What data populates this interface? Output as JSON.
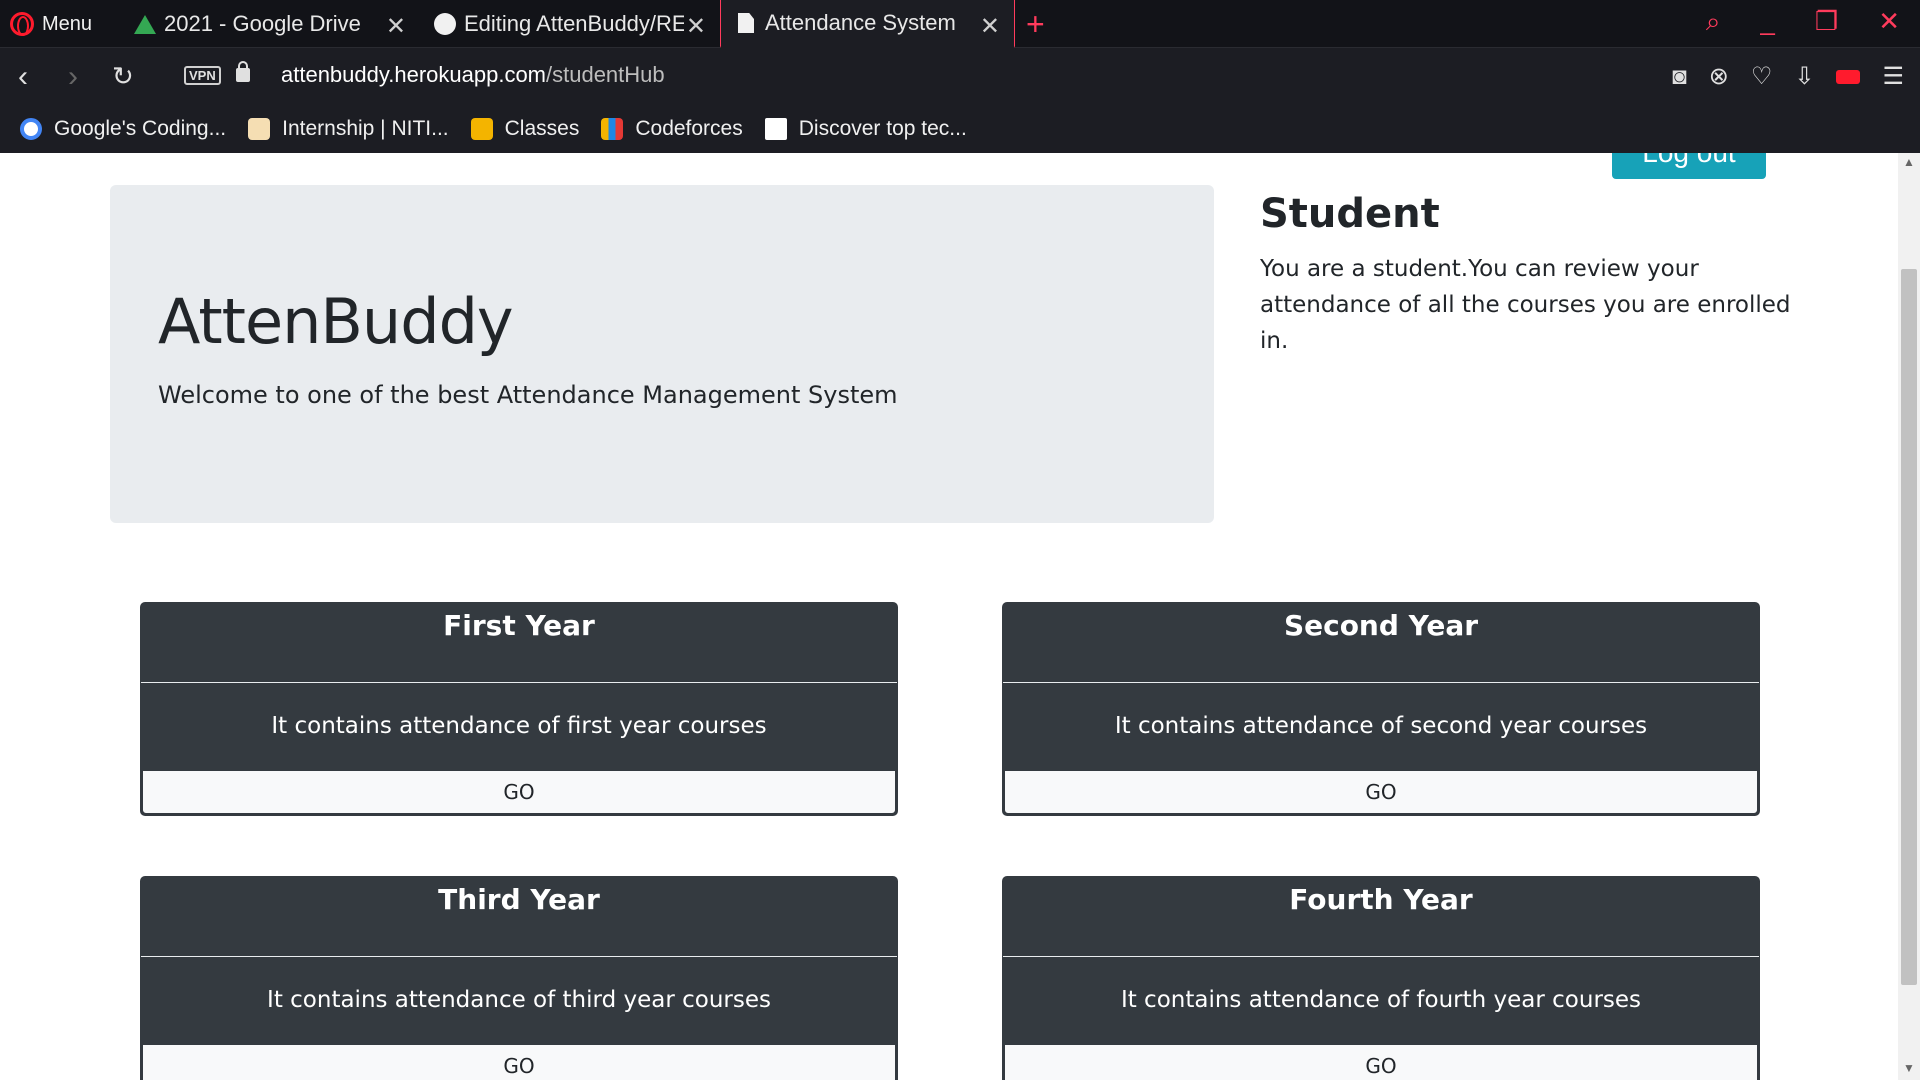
{
  "browser": {
    "menu_label": "Menu",
    "tabs": [
      {
        "title": "2021 - Google Drive",
        "icon": "google-drive-icon"
      },
      {
        "title": "Editing AttenBuddy/RE",
        "icon": "github-icon"
      },
      {
        "title": "Attendance System",
        "icon": "document-icon",
        "active": true
      }
    ],
    "vpn_label": "VPN",
    "url_host": "attenbuddy.herokuapp.com",
    "url_path": "/studentHub",
    "bookmarks": [
      {
        "label": "Google's Coding...",
        "icon": "google-icon"
      },
      {
        "label": "Internship | NITI...",
        "icon": "niti-icon"
      },
      {
        "label": "Classes",
        "icon": "classroom-icon"
      },
      {
        "label": "Codeforces",
        "icon": "codeforces-icon"
      },
      {
        "label": "Discover top tec...",
        "icon": "hackernoon-icon"
      }
    ],
    "accent_color": "#ff3b5c"
  },
  "page": {
    "logout_label": "Log out",
    "brand": "AttenBuddy",
    "tagline": "Welcome to one of the best Attendance Management System",
    "role_title": "Student",
    "role_desc": "You are a student.You can review your attendance of all the courses you are enrolled in.",
    "years": [
      {
        "title": "First Year",
        "desc": "It contains attendance of first year courses",
        "button": "GO"
      },
      {
        "title": "Second Year",
        "desc": "It contains attendance of second year courses",
        "button": "GO"
      },
      {
        "title": "Third Year",
        "desc": "It contains attendance of third year courses",
        "button": "GO"
      },
      {
        "title": "Fourth Year",
        "desc": "It contains attendance of fourth year courses",
        "button": "GO"
      }
    ]
  }
}
